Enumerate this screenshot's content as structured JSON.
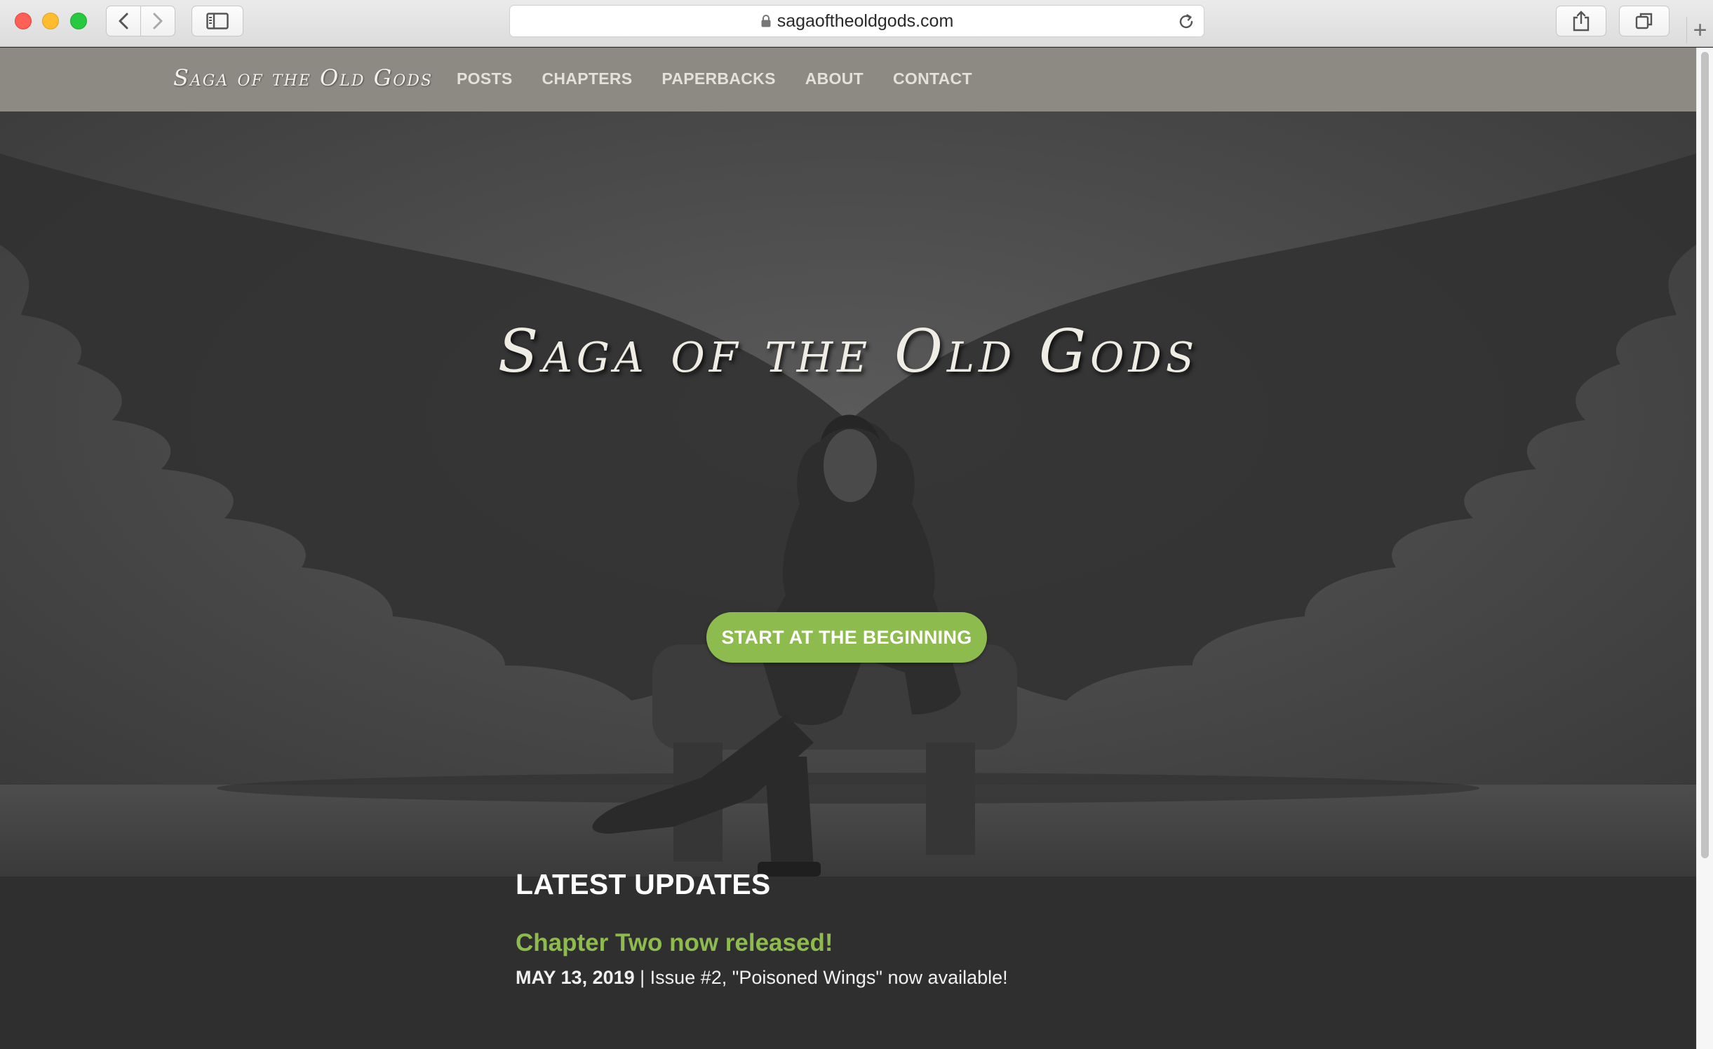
{
  "browser": {
    "url": "sagaoftheoldgods.com",
    "new_tab_glyph": "+",
    "icons": [
      "back-icon",
      "forward-icon",
      "sidebar-icon",
      "lock-icon",
      "reload-icon",
      "share-icon",
      "tabs-icon"
    ]
  },
  "site": {
    "logo_text": "Saga of the Old Gods",
    "nav": [
      "POSTS",
      "CHAPTERS",
      "PAPERBACKS",
      "ABOUT",
      "CONTACT"
    ],
    "colors": {
      "nav_bg": "#8c8a82",
      "accent_green": "#8dbb4e"
    }
  },
  "hero": {
    "title": "Saga of the Old Gods",
    "cta_label": "START AT THE BEGINNING"
  },
  "updates": {
    "heading": "LATEST UPDATES",
    "posts": [
      {
        "title": "Chapter Two now released!",
        "date": "MAY 13, 2019",
        "separator": " | ",
        "summary": "Issue #2, \"Poisoned Wings\" now available!"
      }
    ]
  }
}
